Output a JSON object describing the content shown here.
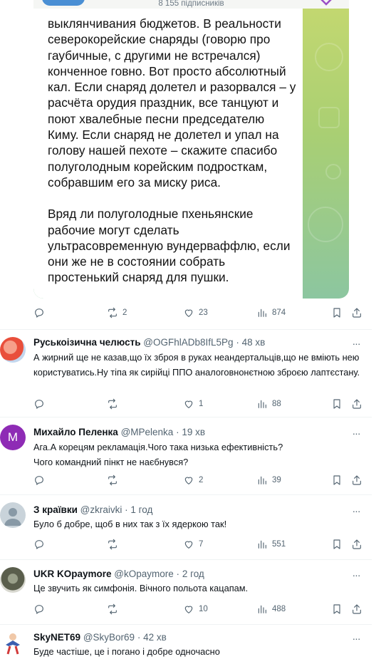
{
  "post": {
    "channel_subscribers": "8 155 підписників",
    "paragraphs": [
      "выклянчивания бюджетов. В реальности северокорейские снаряды (говорю про гаубичные, с другими не встречался) конченное говно. Вот просто абсолютный кал. Если снаряд долетел и разорвался – у расчёта орудия праздник, все танцуют и поют хвалебные песни председателю Киму. Если снаряд не долетел и упал на голову нашей пехоте – скажите спасибо полуголодным корейским подросткам, собравшим его за миску риса.",
      "Вряд ли полуголодные пхеньянские рабочие могут сделать ультрасовременную вундерваффлю, если они же не в состоянии собрать простенький снаряд для пушки."
    ],
    "actions": {
      "reposts": "2",
      "likes": "23",
      "views": "874"
    }
  },
  "replies": [
    {
      "name": "Руськоізична челюсть",
      "handle": "@OGFhlADb8IfL5Pg",
      "time": "48 хв",
      "text": "А жирний ще не казав,що їх зброя в руках неандертальців,що не вміють нею користуватись.Ну тіпа як сирійці  ППО аналоговнонєтною зброєю лаптєстану.",
      "reposts": "",
      "likes": "1",
      "views": "88",
      "avatar_color": "#e94f3b",
      "avatar_letter": ""
    },
    {
      "name": "Михайло Пеленка",
      "handle": "@MPelenka",
      "time": "19 хв",
      "text": "Ага.А корецям рекламація.Чого така низька ефективність?\nЧого командний пінкт не наєбнувся?",
      "reposts": "",
      "likes": "2",
      "views": "39",
      "avatar_color": "#8e2bb5",
      "avatar_letter": "M"
    },
    {
      "name": "З краївки",
      "handle": "@zkraivki",
      "time": "1 год",
      "text": "Було б добре, щоб в  них так з їх ядеркою так!",
      "reposts": "",
      "likes": "7",
      "views": "551",
      "avatar_color": "#b9c6d0",
      "avatar_letter": ""
    },
    {
      "name": "UKR KOpaymore",
      "handle": "@kOpaymore",
      "time": "2 год",
      "text": "Це звучить як симфонія. Вічного польота кацапам.",
      "reposts": "",
      "likes": "10",
      "views": "488",
      "avatar_color": "#6b6f5a",
      "avatar_letter": ""
    },
    {
      "name": "SkyNET69",
      "handle": "@SkyBor69",
      "time": "42 хв",
      "text": "Буде частіше, це і погано і добре одночасно",
      "reposts": "",
      "likes": "",
      "views": "",
      "avatar_color": "#3b5fb0",
      "avatar_letter": ""
    }
  ],
  "ui": {
    "separator": "·",
    "more": "···"
  },
  "colors": {
    "text": "#0f1419",
    "secondary": "#536471",
    "divider": "#eff3f4",
    "telegram_bg": "#b5d36f"
  }
}
